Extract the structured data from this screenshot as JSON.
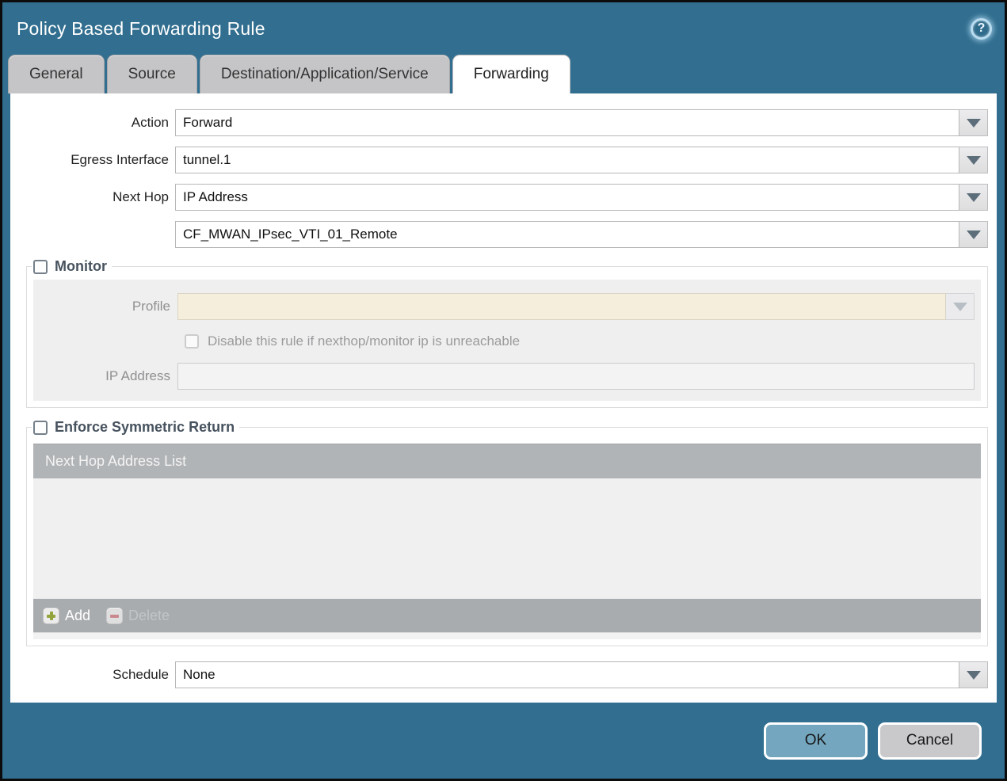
{
  "window": {
    "title": "Policy Based Forwarding Rule",
    "ok_label": "OK",
    "cancel_label": "Cancel"
  },
  "icons": {
    "help": "?"
  },
  "tabs": [
    {
      "label": "General",
      "active": false
    },
    {
      "label": "Source",
      "active": false
    },
    {
      "label": "Destination/Application/Service",
      "active": false
    },
    {
      "label": "Forwarding",
      "active": true
    }
  ],
  "form": {
    "action": {
      "label": "Action",
      "value": "Forward"
    },
    "egress_interface": {
      "label": "Egress Interface",
      "value": "tunnel.1"
    },
    "next_hop": {
      "label": "Next Hop",
      "value": "IP Address"
    },
    "next_hop_address": {
      "value": "CF_MWAN_IPsec_VTI_01_Remote"
    },
    "schedule": {
      "label": "Schedule",
      "value": "None"
    }
  },
  "monitor": {
    "legend": "Monitor",
    "checked": false,
    "profile": {
      "label": "Profile",
      "value": ""
    },
    "disable_rule": {
      "label": "Disable this rule if nexthop/monitor ip is unreachable",
      "checked": false
    },
    "ip_address": {
      "label": "IP Address",
      "value": ""
    }
  },
  "enforce_symmetric_return": {
    "legend": "Enforce Symmetric Return",
    "checked": false,
    "table": {
      "header": "Next Hop Address List",
      "rows": []
    },
    "add_label": "Add",
    "delete_label": "Delete"
  },
  "colors": {
    "titlebar_teal": "#316e8f",
    "ok_button": "#74a7bf",
    "cancel_button": "#c9c9cc",
    "disabled_profile_field": "#f5eedd",
    "table_header_gray": "#b1b4b6",
    "add_icon_green": "#94a43c",
    "delete_icon_red": "#c9898f"
  }
}
